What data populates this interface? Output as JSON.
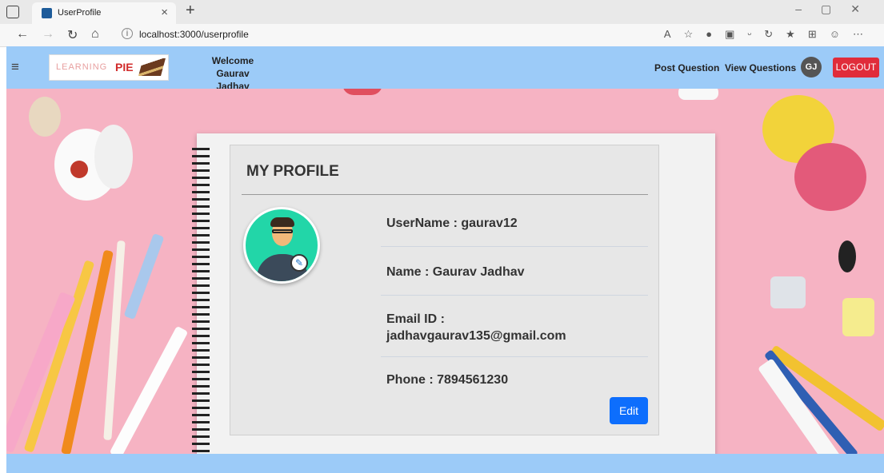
{
  "browser": {
    "tab_title": "UserProfile",
    "url": "localhost:3000/userprofile"
  },
  "navbar": {
    "logo_text_light": "LEARNING",
    "logo_text_bold": "PIE",
    "welcome_line1": "Welcome",
    "welcome_line2": "Gaurav Jadhav",
    "post_question": "Post Question",
    "view_questions": "View Questions",
    "avatar_initials": "GJ",
    "logout": "LOGOUT"
  },
  "profile": {
    "title": "MY PROFILE",
    "username": "UserName : gaurav12",
    "name": "Name : Gaurav Jadhav",
    "email_label": "Email ID :",
    "email_value": "jadhavgaurav135@gmail.com",
    "phone": "Phone : 7894561230",
    "edit_label": "Edit"
  },
  "colors": {
    "navbar_bg": "#9ccbf8",
    "logout_bg": "#e02c3a",
    "edit_bg": "#0d6efd",
    "avatar_bg": "#22d6a8"
  }
}
